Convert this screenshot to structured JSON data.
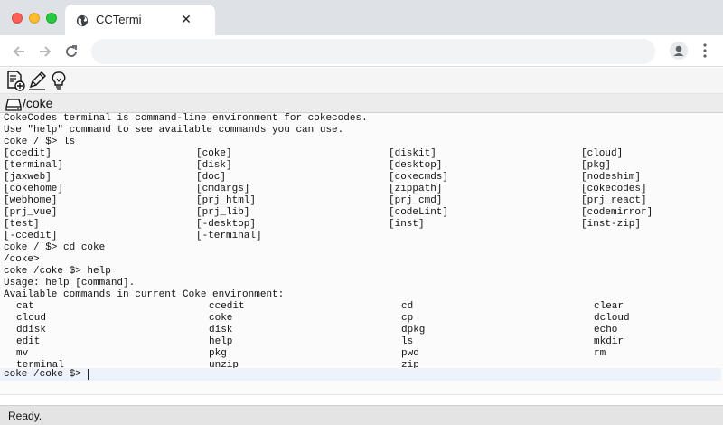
{
  "browser": {
    "tab_title": "CCTermi",
    "tab_close": "✕",
    "url": ""
  },
  "toolbar": {
    "icons": [
      "new-file-icon",
      "edit-pencil-icon",
      "lightbulb-icon"
    ]
  },
  "path_bar": {
    "path": "/coke"
  },
  "terminal": {
    "intro": [
      "CokeCodes terminal is command-line environment for cokecodes.",
      "Use \"help\" command to see available commands you can use.",
      "coke / $> ls"
    ],
    "ls_rows": [
      [
        "[ccedit]",
        "[coke]",
        "[diskit]",
        "[cloud]"
      ],
      [
        "[terminal]",
        "[disk]",
        "[desktop]",
        "[pkg]"
      ],
      [
        "[jaxweb]",
        "[doc]",
        "[cokecmds]",
        "[nodeshim]"
      ],
      [
        "[cokehome]",
        "[cmdargs]",
        "[zippath]",
        "[cokecodes]"
      ],
      [
        "[webhome]",
        "[prj_html]",
        "[prj_cmd]",
        "[prj_react]"
      ],
      [
        "[prj_vue]",
        "[prj_lib]",
        "[codeLint]",
        "[codemirror]"
      ],
      [
        "[test]",
        "[-desktop]",
        "[inst]",
        "[inst-zip]"
      ],
      [
        "[-ccedit]",
        "[-terminal]",
        "",
        ""
      ]
    ],
    "after_ls": [
      "coke / $> cd coke",
      "/coke>",
      "coke /coke $> help",
      "Usage: help [command].",
      "Available commands in current Coke environment:"
    ],
    "help_rows": [
      [
        "cat",
        "ccedit",
        "cd",
        "clear"
      ],
      [
        "cloud",
        "coke",
        "cp",
        "dcloud"
      ],
      [
        "ddisk",
        "disk",
        "dpkg",
        "echo"
      ],
      [
        "edit",
        "help",
        "ls",
        "mkdir"
      ],
      [
        "mv",
        "pkg",
        "pwd",
        "rm"
      ],
      [
        "terminal",
        "unzip",
        "zip",
        ""
      ]
    ],
    "prompt": "coke /coke $> "
  },
  "status": {
    "text": "Ready."
  }
}
